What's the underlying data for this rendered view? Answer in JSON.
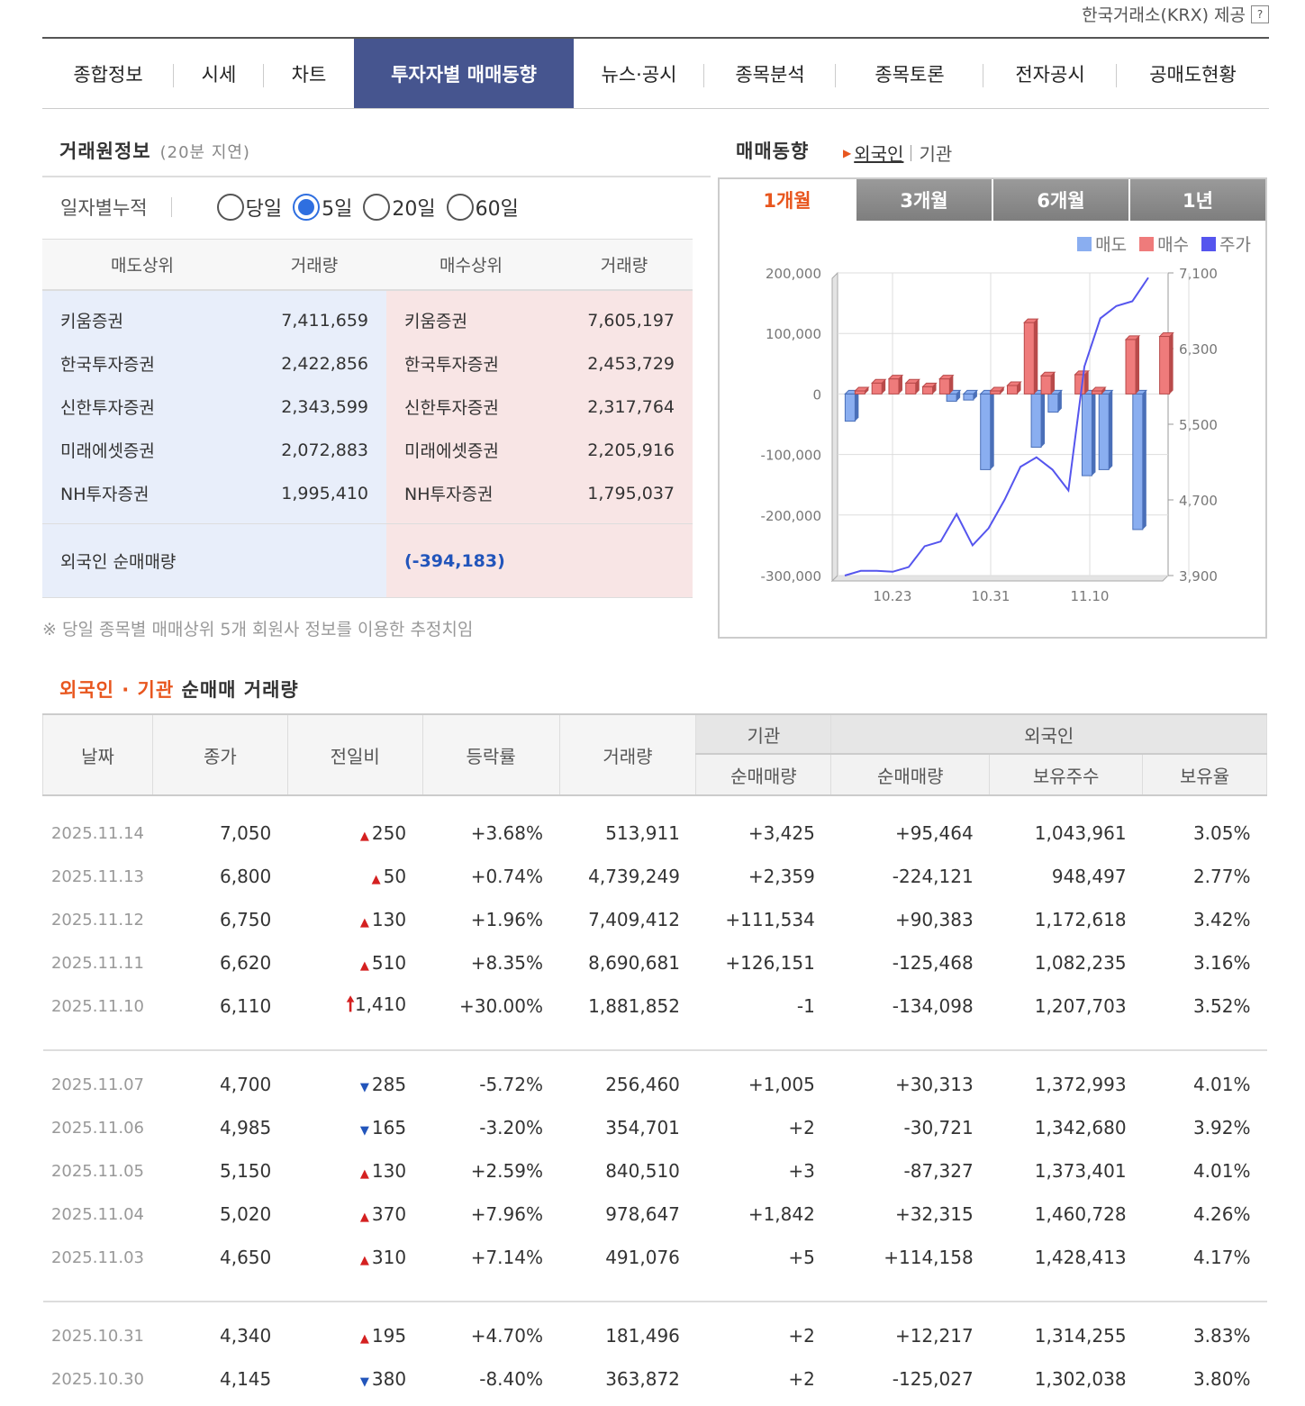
{
  "provider": {
    "text": "한국거래소(KRX) 제공",
    "icon": "?"
  },
  "tabs": [
    {
      "label": "종합정보"
    },
    {
      "label": "시세"
    },
    {
      "label": "차트"
    },
    {
      "label": "투자자별 매매동향"
    },
    {
      "label": "뉴스·공시"
    },
    {
      "label": "종목분석"
    },
    {
      "label": "종목토론"
    },
    {
      "label": "전자공시"
    },
    {
      "label": "공매도현황"
    }
  ],
  "broker": {
    "title": "거래원정보",
    "delay": "(20분 지연)",
    "cumulative_label": "일자별누적",
    "periods": [
      "당일",
      "5일",
      "20일",
      "60일"
    ],
    "selected_period": "5일",
    "headers": {
      "sell": "매도상위",
      "sell_vol": "거래량",
      "buy": "매수상위",
      "buy_vol": "거래량"
    },
    "rows": [
      {
        "sell": "키움증권",
        "sell_vol": "7,411,659",
        "buy": "키움증권",
        "buy_vol": "7,605,197"
      },
      {
        "sell": "한국투자증권",
        "sell_vol": "2,422,856",
        "buy": "한국투자증권",
        "buy_vol": "2,453,729"
      },
      {
        "sell": "신한투자증권",
        "sell_vol": "2,343,599",
        "buy": "신한투자증권",
        "buy_vol": "2,317,764"
      },
      {
        "sell": "미래에셋증권",
        "sell_vol": "2,072,883",
        "buy": "미래에셋증권",
        "buy_vol": "2,205,916"
      },
      {
        "sell": "NH투자증권",
        "sell_vol": "1,995,410",
        "buy": "NH투자증권",
        "buy_vol": "1,795,037"
      }
    ],
    "net_label": "외국인 순매매량",
    "net_value": "(-394,183)",
    "note": "※ 당일 종목별 매매상위 5개 회원사 정보를 이용한 추정치임"
  },
  "trend": {
    "title": "매매동향",
    "link_foreign": "외국인",
    "link_inst": "기관",
    "chart_tabs": [
      "1개월",
      "3개월",
      "6개월",
      "1년"
    ],
    "active_tab": "1개월",
    "legend": [
      {
        "label": "매도",
        "color": "#8aaef0"
      },
      {
        "label": "매수",
        "color": "#ef7b7b"
      },
      {
        "label": "주가",
        "color": "#5555ee"
      }
    ]
  },
  "chart_data": {
    "type": "bar",
    "title": "",
    "x_ticks": [
      "10.23",
      "10.31",
      "11.10"
    ],
    "left_axis": {
      "ticks": [
        "200,000",
        "100,000",
        "0",
        "-100,000",
        "-200,000",
        "-300,000"
      ],
      "ylim": [
        -300000,
        200000
      ]
    },
    "right_axis": {
      "ticks": [
        "7,100",
        "6,300",
        "5,500",
        "4,700",
        "3,900"
      ],
      "ylim": [
        3900,
        7100
      ]
    },
    "series": [
      {
        "name": "매도",
        "values": [
          -45000,
          0,
          0,
          0,
          0,
          0,
          -12000,
          -10000,
          -125000,
          0,
          0,
          -88000,
          -30000,
          0,
          -135000,
          -125000,
          0,
          -224000,
          0
        ]
      },
      {
        "name": "매수",
        "values": [
          5000,
          18000,
          25000,
          18000,
          12000,
          25000,
          0,
          0,
          5000,
          14000,
          118000,
          30000,
          0,
          32000,
          5000,
          0,
          90000,
          0,
          95000
        ]
      },
      {
        "name": "주가",
        "values": [
          3900,
          3950,
          3950,
          3940,
          3990,
          4210,
          4260,
          4550,
          4220,
          4400,
          4700,
          5050,
          5150,
          5020,
          4800,
          6110,
          6620,
          6750,
          6800,
          7050
        ]
      }
    ],
    "grid": true,
    "legend_position": "top-right"
  },
  "net_table": {
    "title_highlight": "외국인 · 기관",
    "title_rest": "순매매 거래량",
    "headers": {
      "date": "날짜",
      "close": "종가",
      "change": "전일비",
      "rate": "등락률",
      "volume": "거래량",
      "inst_group": "기관",
      "inst_net": "순매매량",
      "foreign_group": "외국인",
      "foreign_net": "순매매량",
      "holdings": "보유주수",
      "ratio": "보유율"
    },
    "groups": [
      [
        {
          "date": "2025.11.14",
          "close": "7,050",
          "dir": "up",
          "change": "250",
          "rate": "+3.68%",
          "volume": "513,911",
          "inst": "+3,425",
          "foreign": "+95,464",
          "holdings": "1,043,961",
          "ratio": "3.05%"
        },
        {
          "date": "2025.11.13",
          "close": "6,800",
          "dir": "up",
          "change": "50",
          "rate": "+0.74%",
          "volume": "4,739,249",
          "inst": "+2,359",
          "foreign": "-224,121",
          "holdings": "948,497",
          "ratio": "2.77%"
        },
        {
          "date": "2025.11.12",
          "close": "6,750",
          "dir": "up",
          "change": "130",
          "rate": "+1.96%",
          "volume": "7,409,412",
          "inst": "+111,534",
          "foreign": "+90,383",
          "holdings": "1,172,618",
          "ratio": "3.42%"
        },
        {
          "date": "2025.11.11",
          "close": "6,620",
          "dir": "up",
          "change": "510",
          "rate": "+8.35%",
          "volume": "8,690,681",
          "inst": "+126,151",
          "foreign": "-125,468",
          "holdings": "1,082,235",
          "ratio": "3.16%"
        },
        {
          "date": "2025.11.10",
          "close": "6,110",
          "dir": "limit",
          "change": "1,410",
          "rate": "+30.00%",
          "volume": "1,881,852",
          "inst": "-1",
          "foreign": "-134,098",
          "holdings": "1,207,703",
          "ratio": "3.52%"
        }
      ],
      [
        {
          "date": "2025.11.07",
          "close": "4,700",
          "dir": "down",
          "change": "285",
          "rate": "-5.72%",
          "volume": "256,460",
          "inst": "+1,005",
          "foreign": "+30,313",
          "holdings": "1,372,993",
          "ratio": "4.01%"
        },
        {
          "date": "2025.11.06",
          "close": "4,985",
          "dir": "down",
          "change": "165",
          "rate": "-3.20%",
          "volume": "354,701",
          "inst": "+2",
          "foreign": "-30,721",
          "holdings": "1,342,680",
          "ratio": "3.92%"
        },
        {
          "date": "2025.11.05",
          "close": "5,150",
          "dir": "up",
          "change": "130",
          "rate": "+2.59%",
          "volume": "840,510",
          "inst": "+3",
          "foreign": "-87,327",
          "holdings": "1,373,401",
          "ratio": "4.01%"
        },
        {
          "date": "2025.11.04",
          "close": "5,020",
          "dir": "up",
          "change": "370",
          "rate": "+7.96%",
          "volume": "978,647",
          "inst": "+1,842",
          "foreign": "+32,315",
          "holdings": "1,460,728",
          "ratio": "4.26%"
        },
        {
          "date": "2025.11.03",
          "close": "4,650",
          "dir": "up",
          "change": "310",
          "rate": "+7.14%",
          "volume": "491,076",
          "inst": "+5",
          "foreign": "+114,158",
          "holdings": "1,428,413",
          "ratio": "4.17%"
        }
      ],
      [
        {
          "date": "2025.10.31",
          "close": "4,340",
          "dir": "up",
          "change": "195",
          "rate": "+4.70%",
          "volume": "181,496",
          "inst": "+2",
          "foreign": "+12,217",
          "holdings": "1,314,255",
          "ratio": "3.83%"
        },
        {
          "date": "2025.10.30",
          "close": "4,145",
          "dir": "down",
          "change": "380",
          "rate": "-8.40%",
          "volume": "363,872",
          "inst": "+2",
          "foreign": "-125,027",
          "holdings": "1,302,038",
          "ratio": "3.80%"
        }
      ]
    ]
  }
}
